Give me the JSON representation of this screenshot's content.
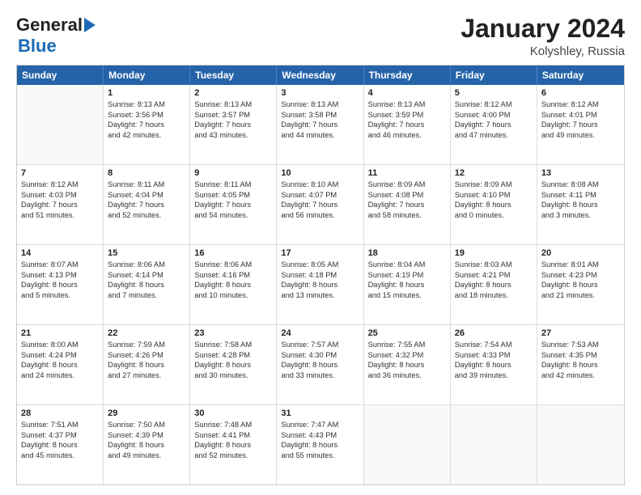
{
  "header": {
    "logo_line1": "General",
    "logo_line2": "Blue",
    "main_title": "January 2024",
    "subtitle": "Kolyshley, Russia"
  },
  "days_of_week": [
    "Sunday",
    "Monday",
    "Tuesday",
    "Wednesday",
    "Thursday",
    "Friday",
    "Saturday"
  ],
  "weeks": [
    [
      {
        "day": "",
        "empty": true,
        "lines": []
      },
      {
        "day": "1",
        "empty": false,
        "lines": [
          "Sunrise: 8:13 AM",
          "Sunset: 3:56 PM",
          "Daylight: 7 hours",
          "and 42 minutes."
        ]
      },
      {
        "day": "2",
        "empty": false,
        "lines": [
          "Sunrise: 8:13 AM",
          "Sunset: 3:57 PM",
          "Daylight: 7 hours",
          "and 43 minutes."
        ]
      },
      {
        "day": "3",
        "empty": false,
        "lines": [
          "Sunrise: 8:13 AM",
          "Sunset: 3:58 PM",
          "Daylight: 7 hours",
          "and 44 minutes."
        ]
      },
      {
        "day": "4",
        "empty": false,
        "lines": [
          "Sunrise: 8:13 AM",
          "Sunset: 3:59 PM",
          "Daylight: 7 hours",
          "and 46 minutes."
        ]
      },
      {
        "day": "5",
        "empty": false,
        "lines": [
          "Sunrise: 8:12 AM",
          "Sunset: 4:00 PM",
          "Daylight: 7 hours",
          "and 47 minutes."
        ]
      },
      {
        "day": "6",
        "empty": false,
        "lines": [
          "Sunrise: 8:12 AM",
          "Sunset: 4:01 PM",
          "Daylight: 7 hours",
          "and 49 minutes."
        ]
      }
    ],
    [
      {
        "day": "7",
        "empty": false,
        "lines": [
          "Sunrise: 8:12 AM",
          "Sunset: 4:03 PM",
          "Daylight: 7 hours",
          "and 51 minutes."
        ]
      },
      {
        "day": "8",
        "empty": false,
        "lines": [
          "Sunrise: 8:11 AM",
          "Sunset: 4:04 PM",
          "Daylight: 7 hours",
          "and 52 minutes."
        ]
      },
      {
        "day": "9",
        "empty": false,
        "lines": [
          "Sunrise: 8:11 AM",
          "Sunset: 4:05 PM",
          "Daylight: 7 hours",
          "and 54 minutes."
        ]
      },
      {
        "day": "10",
        "empty": false,
        "lines": [
          "Sunrise: 8:10 AM",
          "Sunset: 4:07 PM",
          "Daylight: 7 hours",
          "and 56 minutes."
        ]
      },
      {
        "day": "11",
        "empty": false,
        "lines": [
          "Sunrise: 8:09 AM",
          "Sunset: 4:08 PM",
          "Daylight: 7 hours",
          "and 58 minutes."
        ]
      },
      {
        "day": "12",
        "empty": false,
        "lines": [
          "Sunrise: 8:09 AM",
          "Sunset: 4:10 PM",
          "Daylight: 8 hours",
          "and 0 minutes."
        ]
      },
      {
        "day": "13",
        "empty": false,
        "lines": [
          "Sunrise: 8:08 AM",
          "Sunset: 4:11 PM",
          "Daylight: 8 hours",
          "and 3 minutes."
        ]
      }
    ],
    [
      {
        "day": "14",
        "empty": false,
        "lines": [
          "Sunrise: 8:07 AM",
          "Sunset: 4:13 PM",
          "Daylight: 8 hours",
          "and 5 minutes."
        ]
      },
      {
        "day": "15",
        "empty": false,
        "lines": [
          "Sunrise: 8:06 AM",
          "Sunset: 4:14 PM",
          "Daylight: 8 hours",
          "and 7 minutes."
        ]
      },
      {
        "day": "16",
        "empty": false,
        "lines": [
          "Sunrise: 8:06 AM",
          "Sunset: 4:16 PM",
          "Daylight: 8 hours",
          "and 10 minutes."
        ]
      },
      {
        "day": "17",
        "empty": false,
        "lines": [
          "Sunrise: 8:05 AM",
          "Sunset: 4:18 PM",
          "Daylight: 8 hours",
          "and 13 minutes."
        ]
      },
      {
        "day": "18",
        "empty": false,
        "lines": [
          "Sunrise: 8:04 AM",
          "Sunset: 4:19 PM",
          "Daylight: 8 hours",
          "and 15 minutes."
        ]
      },
      {
        "day": "19",
        "empty": false,
        "lines": [
          "Sunrise: 8:03 AM",
          "Sunset: 4:21 PM",
          "Daylight: 8 hours",
          "and 18 minutes."
        ]
      },
      {
        "day": "20",
        "empty": false,
        "lines": [
          "Sunrise: 8:01 AM",
          "Sunset: 4:23 PM",
          "Daylight: 8 hours",
          "and 21 minutes."
        ]
      }
    ],
    [
      {
        "day": "21",
        "empty": false,
        "lines": [
          "Sunrise: 8:00 AM",
          "Sunset: 4:24 PM",
          "Daylight: 8 hours",
          "and 24 minutes."
        ]
      },
      {
        "day": "22",
        "empty": false,
        "lines": [
          "Sunrise: 7:59 AM",
          "Sunset: 4:26 PM",
          "Daylight: 8 hours",
          "and 27 minutes."
        ]
      },
      {
        "day": "23",
        "empty": false,
        "lines": [
          "Sunrise: 7:58 AM",
          "Sunset: 4:28 PM",
          "Daylight: 8 hours",
          "and 30 minutes."
        ]
      },
      {
        "day": "24",
        "empty": false,
        "lines": [
          "Sunrise: 7:57 AM",
          "Sunset: 4:30 PM",
          "Daylight: 8 hours",
          "and 33 minutes."
        ]
      },
      {
        "day": "25",
        "empty": false,
        "lines": [
          "Sunrise: 7:55 AM",
          "Sunset: 4:32 PM",
          "Daylight: 8 hours",
          "and 36 minutes."
        ]
      },
      {
        "day": "26",
        "empty": false,
        "lines": [
          "Sunrise: 7:54 AM",
          "Sunset: 4:33 PM",
          "Daylight: 8 hours",
          "and 39 minutes."
        ]
      },
      {
        "day": "27",
        "empty": false,
        "lines": [
          "Sunrise: 7:53 AM",
          "Sunset: 4:35 PM",
          "Daylight: 8 hours",
          "and 42 minutes."
        ]
      }
    ],
    [
      {
        "day": "28",
        "empty": false,
        "lines": [
          "Sunrise: 7:51 AM",
          "Sunset: 4:37 PM",
          "Daylight: 8 hours",
          "and 45 minutes."
        ]
      },
      {
        "day": "29",
        "empty": false,
        "lines": [
          "Sunrise: 7:50 AM",
          "Sunset: 4:39 PM",
          "Daylight: 8 hours",
          "and 49 minutes."
        ]
      },
      {
        "day": "30",
        "empty": false,
        "lines": [
          "Sunrise: 7:48 AM",
          "Sunset: 4:41 PM",
          "Daylight: 8 hours",
          "and 52 minutes."
        ]
      },
      {
        "day": "31",
        "empty": false,
        "lines": [
          "Sunrise: 7:47 AM",
          "Sunset: 4:43 PM",
          "Daylight: 8 hours",
          "and 55 minutes."
        ]
      },
      {
        "day": "",
        "empty": true,
        "lines": []
      },
      {
        "day": "",
        "empty": true,
        "lines": []
      },
      {
        "day": "",
        "empty": true,
        "lines": []
      }
    ]
  ]
}
